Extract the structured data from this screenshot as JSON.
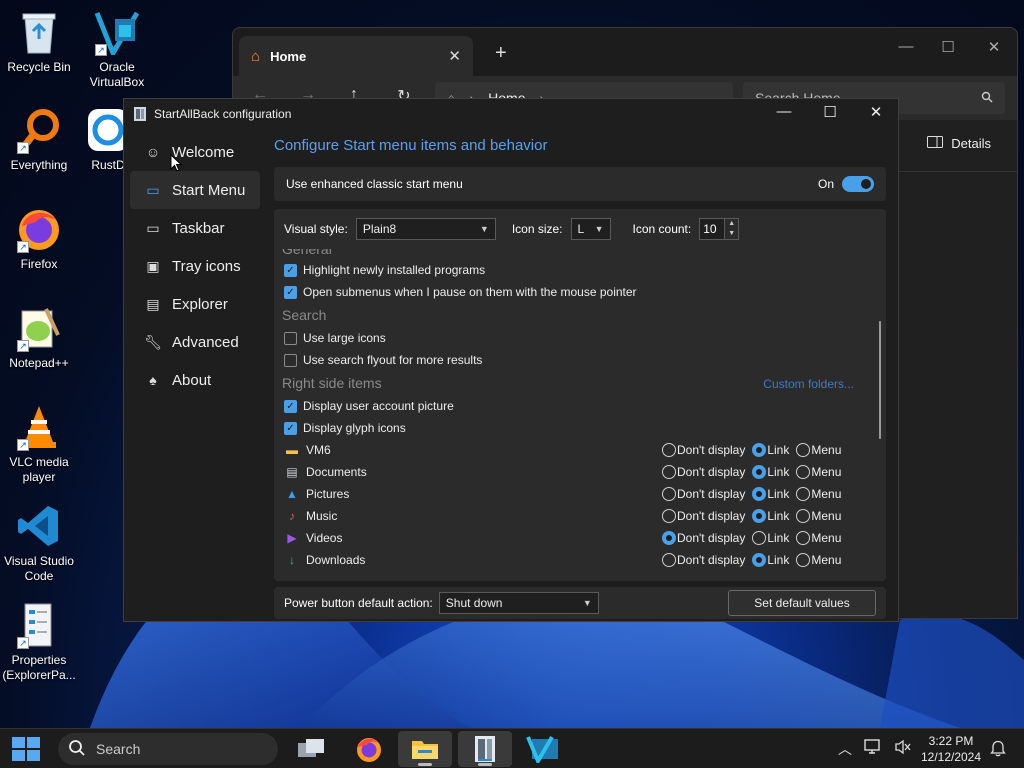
{
  "desktop": {
    "icons": [
      {
        "label": "Recycle Bin",
        "icon": "recycle-bin-icon"
      },
      {
        "label": "Oracle VirtualBox",
        "icon": "virtualbox-icon"
      },
      {
        "label": "Everything",
        "icon": "everything-search-icon"
      },
      {
        "label": "RustD",
        "icon": "rustdesk-icon"
      },
      {
        "label": "Firefox",
        "icon": "firefox-icon"
      },
      {
        "label": "Notepad++",
        "icon": "notepadpp-icon"
      },
      {
        "label": "VLC media player",
        "icon": "vlc-icon"
      },
      {
        "label": "Visual Studio Code",
        "icon": "vscode-icon"
      },
      {
        "label": "Properties (ExplorerPa...",
        "icon": "properties-icon"
      }
    ]
  },
  "explorer": {
    "tab_label": "Home",
    "address": "Home",
    "search_placeholder": "Search Home",
    "details_label": "Details"
  },
  "sab": {
    "title": "StartAllBack configuration",
    "sidebar": [
      {
        "label": "Welcome",
        "icon": "smile-icon"
      },
      {
        "label": "Start Menu",
        "icon": "start-menu-icon"
      },
      {
        "label": "Taskbar",
        "icon": "taskbar-icon"
      },
      {
        "label": "Tray icons",
        "icon": "tray-icon"
      },
      {
        "label": "Explorer",
        "icon": "folder-icon"
      },
      {
        "label": "Advanced",
        "icon": "wrench-icon"
      },
      {
        "label": "About",
        "icon": "about-icon"
      }
    ],
    "page_title": "Configure Start menu items and behavior",
    "enhanced": {
      "label": "Use enhanced classic start menu",
      "state": "On"
    },
    "visual_style": {
      "label": "Visual style:",
      "value": "Plain8"
    },
    "icon_size": {
      "label": "Icon size:",
      "value": "L"
    },
    "icon_count": {
      "label": "Icon count:",
      "value": "10"
    },
    "sections": {
      "general": "General",
      "search": "Search",
      "right": "Right side items",
      "custom_folders": "Custom folders..."
    },
    "checks": [
      {
        "label": "Highlight newly installed programs",
        "checked": true
      },
      {
        "label": "Open submenus when I pause on them with the mouse pointer",
        "checked": true
      },
      {
        "label": "Use large icons",
        "checked": false
      },
      {
        "label": "Use search flyout for more results",
        "checked": false
      },
      {
        "label": "Display user account picture",
        "checked": true
      },
      {
        "label": "Display glyph icons",
        "checked": true
      }
    ],
    "radio_labels": [
      "Don't display",
      "Link",
      "Menu"
    ],
    "folders": [
      {
        "label": "VM6",
        "icon": "folder-icon",
        "selected": 1
      },
      {
        "label": "Documents",
        "icon": "documents-icon",
        "selected": 1
      },
      {
        "label": "Pictures",
        "icon": "pictures-icon",
        "selected": 1
      },
      {
        "label": "Music",
        "icon": "music-icon",
        "selected": 1
      },
      {
        "label": "Videos",
        "icon": "videos-icon",
        "selected": 0
      },
      {
        "label": "Downloads",
        "icon": "downloads-icon",
        "selected": 1
      }
    ],
    "power": {
      "label": "Power button default action:",
      "value": "Shut down"
    },
    "default_button": "Set default values"
  },
  "taskbar": {
    "search_placeholder": "Search",
    "time": "3:22 PM",
    "date": "12/12/2024"
  },
  "colors": {
    "accent": "#4aa0e8",
    "title_blue": "#5aa0f0",
    "link": "#3a7cc8"
  }
}
